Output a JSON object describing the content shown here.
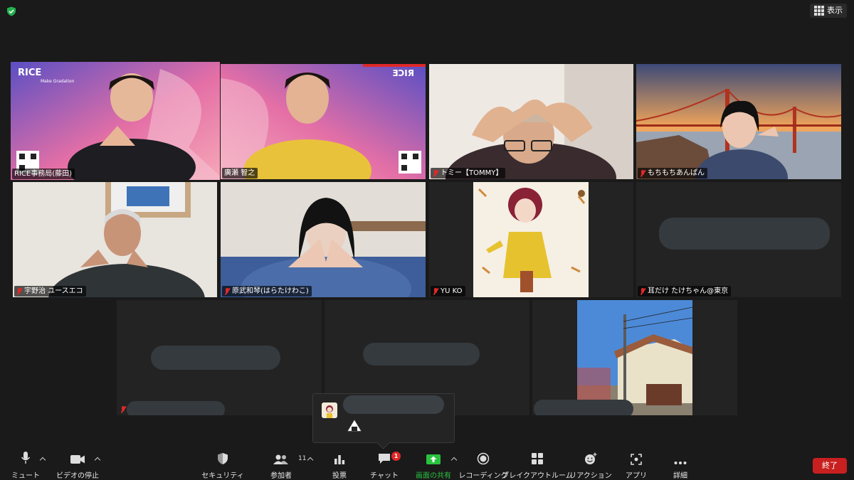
{
  "topbar": {
    "view_label": "表示"
  },
  "participants": [
    {
      "name": "RICE事務局(藤田)",
      "muted": false,
      "active": true
    },
    {
      "name": "廣瀬 智之",
      "muted": false,
      "active": false
    },
    {
      "name": "トミー【TOMMY】",
      "muted": true,
      "active": false
    },
    {
      "name": "もちもちあんぱん",
      "muted": true,
      "active": false
    },
    {
      "name": "宇野治 ユースエコ",
      "muted": true,
      "active": false
    },
    {
      "name": "原武和琴(はらたけわこ)",
      "muted": true,
      "active": false
    },
    {
      "name": "YU KO",
      "muted": true,
      "active": false
    },
    {
      "name": "耳だけ たけちゃん@東京",
      "muted": true,
      "active": false
    }
  ],
  "branding": {
    "logo_text": "RICE",
    "tagline": "Make Gradation"
  },
  "toolbar": {
    "mute": "ミュート",
    "stop_video": "ビデオの停止",
    "security": "セキュリティ",
    "participants": "参加者",
    "participants_count": "11",
    "poll": "投票",
    "chat": "チャット",
    "chat_badge": "1",
    "share_screen": "画面の共有",
    "recording": "レコーディング",
    "breakout": "ブレイクアウトルーム",
    "reactions": "リアクション",
    "apps": "アプリ",
    "more": "詳細",
    "end": "終了"
  },
  "colors": {
    "active_border": "#d6e34a",
    "share_green": "#29c23f",
    "end_red": "#c8201f",
    "muted_red": "#e02828"
  }
}
